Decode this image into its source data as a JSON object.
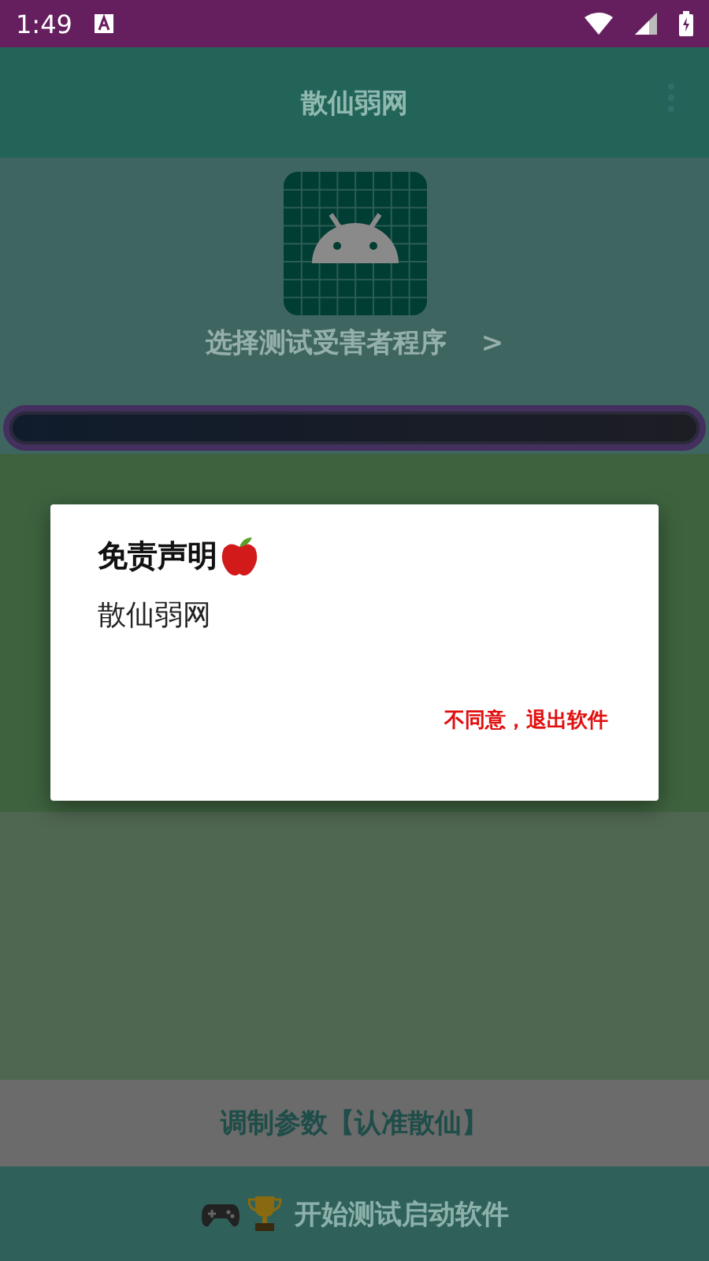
{
  "status_bar": {
    "time": "1:49"
  },
  "toolbar": {
    "title": "散仙弱网"
  },
  "target": {
    "label": "选择测试受害者程序",
    "chevron": ">"
  },
  "params_button": {
    "label": "调制参数【认准散仙】"
  },
  "start_button": {
    "label": "开始测试启动软件"
  },
  "dialog": {
    "title": "免责声明",
    "message": "散仙弱网",
    "button": "不同意，退出软件"
  }
}
